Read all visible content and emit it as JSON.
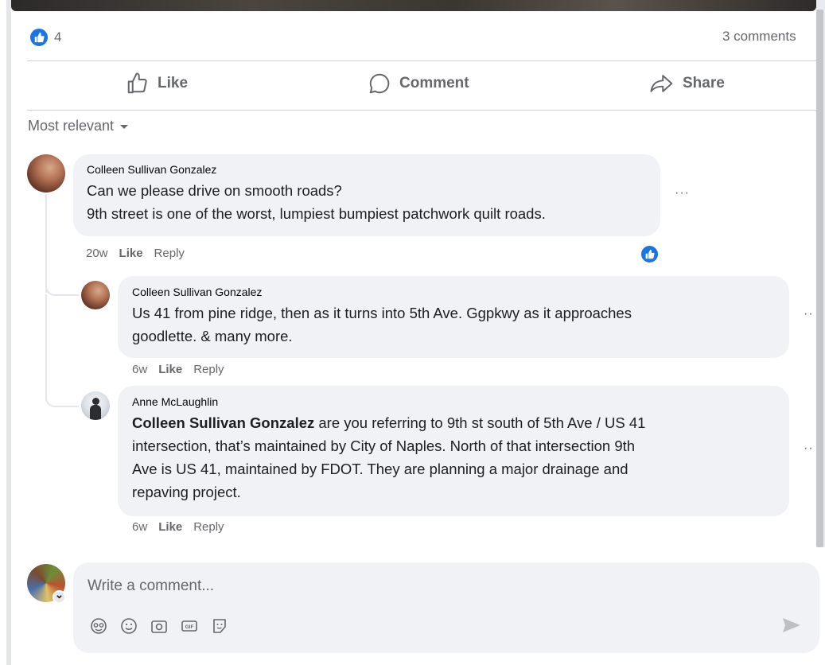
{
  "post": {
    "reaction_count": "4",
    "comments_count": "3 comments"
  },
  "actions": {
    "like": "Like",
    "comment": "Comment",
    "share": "Share"
  },
  "sort": {
    "label": "Most relevant"
  },
  "comments": [
    {
      "author": "Colleen Sullivan Gonzalez",
      "lines": [
        "Can we please drive on smooth roads?",
        "9th street is one of the worst, lumpiest bumpiest patchwork quilt roads."
      ],
      "time": "20w",
      "like": "Like",
      "reply": "Reply",
      "more": "···"
    },
    {
      "author": "Colleen Sullivan Gonzalez",
      "lines": [
        "Us 41 from pine ridge, then as it turns into 5th Ave. Ggpkwy as it approaches",
        "goodlette. & many more."
      ],
      "time": "6w",
      "like": "Like",
      "reply": "Reply",
      "more": "··"
    },
    {
      "author": "Anne McLaughlin",
      "mention": "Colleen Sullivan Gonzalez",
      "line1_rest": " are you referring to 9th st south of 5th Ave / US 41",
      "lines": [
        "intersection, that’s maintained by City of Naples. North of that intersection 9th",
        "Ave is US 41, maintained by FDOT. They are planning a major drainage and",
        "repaving project."
      ],
      "time": "6w",
      "like": "Like",
      "reply": "Reply",
      "more": "··"
    }
  ],
  "composer": {
    "placeholder": "Write a comment..."
  },
  "icons": [
    "like-icon",
    "comment-icon",
    "share-icon",
    "avatar-sticker-icon",
    "emoji-icon",
    "camera-icon",
    "gif-icon",
    "sticker-icon",
    "send-icon"
  ],
  "colors": {
    "accent": "#1b74e4",
    "bubble": "#f0f2f5",
    "muted": "#65676b"
  }
}
